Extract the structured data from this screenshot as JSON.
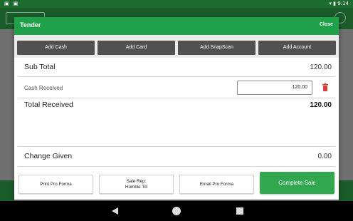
{
  "status_bar": {
    "left_icons": [
      "notification-icon",
      "notification-icon-2"
    ],
    "time": "9:14"
  },
  "dialog": {
    "title": "Tender",
    "close_label": "Close"
  },
  "payment_buttons": [
    {
      "label": "Add Cash"
    },
    {
      "label": "Add Card"
    },
    {
      "label": "Add SnapScan"
    },
    {
      "label": "Add Account"
    }
  ],
  "sub_total": {
    "label": "Sub Total",
    "value": "120.00"
  },
  "cash_received": {
    "label": "Cash Received",
    "value": "120.00"
  },
  "total_received": {
    "label": "Total Received",
    "value": "120.00"
  },
  "change_given": {
    "label": "Change Given",
    "value": "0.00"
  },
  "footer": {
    "print_label": "Print Pro Forma",
    "sale_rep_line1": "Sale Rep:",
    "sale_rep_line2": "Humble Till",
    "email_label": "Email Pro Forma",
    "complete_label": "Complete Sale"
  },
  "colors": {
    "header_green": "#1fa24a",
    "complete_green": "#31a74f",
    "button_dark": "#515151",
    "delete_red": "#e53935"
  }
}
